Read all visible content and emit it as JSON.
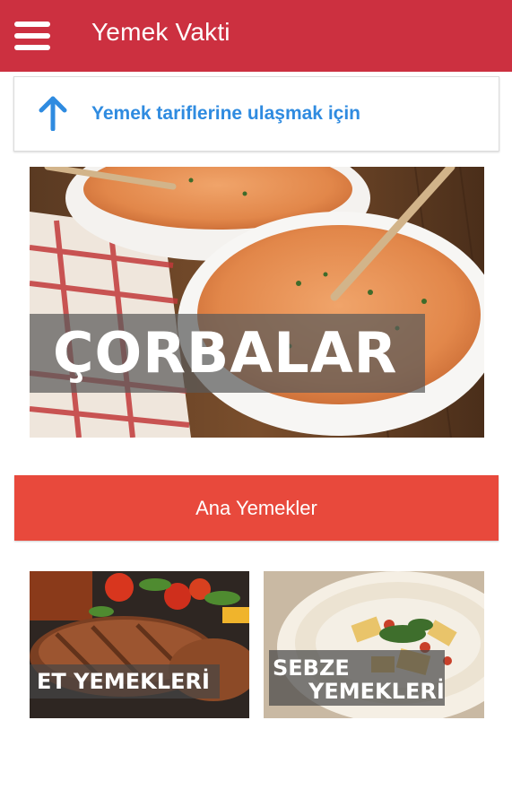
{
  "app": {
    "title": "Yemek Vakti",
    "accent_color": "#cc3040"
  },
  "appbar": {
    "menu_icon": "hamburger-menu-icon"
  },
  "hint": {
    "icon": "arrow-up-icon",
    "text": "Yemek tariflerine ulaşmak için",
    "color": "#2f8be0"
  },
  "categories": {
    "soup": {
      "label": "ÇORBALAR"
    },
    "main_dishes_button": {
      "label": "Ana Yemekler",
      "color": "#e8493c"
    },
    "meat": {
      "label": "ET YEMEKLERİ"
    },
    "vegetable": {
      "label_line1": "SEBZE",
      "label_line2": "YEMEKLERİ"
    }
  }
}
